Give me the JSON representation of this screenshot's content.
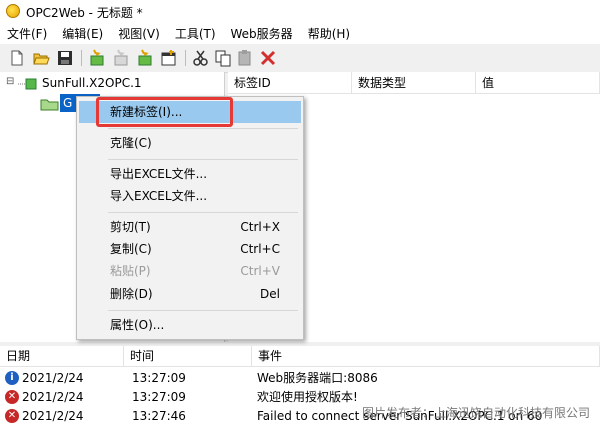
{
  "window": {
    "title": "OPC2Web - 无标题 *"
  },
  "menu": [
    "文件(F)",
    "编辑(E)",
    "视图(V)",
    "工具(T)",
    "Web服务器",
    "帮助(H)"
  ],
  "tree": {
    "root": {
      "expander": "⊟",
      "label": "SunFull.X2OPC.1"
    },
    "child": {
      "label": "G"
    }
  },
  "tag_table": {
    "columns": [
      "标签ID",
      "数据类型",
      "值"
    ]
  },
  "context_menu": {
    "items": [
      {
        "label": "新建标签(I)...",
        "shortcut": "",
        "disabled": false
      },
      {
        "label": "克隆(C)",
        "shortcut": "",
        "disabled": false
      },
      {
        "label": "导出EXCEL文件...",
        "shortcut": "",
        "disabled": false
      },
      {
        "label": "导入EXCEL文件...",
        "shortcut": "",
        "disabled": false
      },
      {
        "label": "剪切(T)",
        "shortcut": "Ctrl+X",
        "disabled": false
      },
      {
        "label": "复制(C)",
        "shortcut": "Ctrl+C",
        "disabled": false
      },
      {
        "label": "粘贴(P)",
        "shortcut": "Ctrl+V",
        "disabled": true
      },
      {
        "label": "删除(D)",
        "shortcut": "Del",
        "disabled": false
      },
      {
        "label": "属性(O)...",
        "shortcut": "",
        "disabled": false
      }
    ]
  },
  "log": {
    "columns": [
      "日期",
      "时间",
      "事件"
    ],
    "rows": [
      {
        "level": "info",
        "icon": "i",
        "date": "2021/2/24",
        "time": "13:27:09",
        "event": "Web服务器端口:8086"
      },
      {
        "level": "error",
        "icon": "✕",
        "date": "2021/2/24",
        "time": "13:27:09",
        "event": "欢迎使用授权版本!"
      },
      {
        "level": "error",
        "icon": "✕",
        "date": "2021/2/24",
        "time": "13:27:46",
        "event": "Failed to connect server SunFull.X2OPC.1 on 60"
      }
    ]
  },
  "watermark": "图片发布者：上海迅饶自动化科技有限公司",
  "colors": {
    "highlight": "#e53935",
    "selection": "#99c9ef",
    "info": "#1e5fc1",
    "error": "#c62828"
  }
}
